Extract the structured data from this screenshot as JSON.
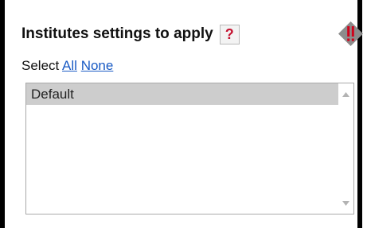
{
  "section": {
    "heading": "Institutes settings to apply",
    "help_label": "?",
    "warning_icon": "warning-diamond-icon"
  },
  "select": {
    "prefix": "Select",
    "all_label": "All",
    "none_label": "None"
  },
  "listbox": {
    "options": [
      {
        "label": "Default",
        "selected": true
      }
    ]
  },
  "colors": {
    "link": "#1a5bc4",
    "help_text": "#c41230",
    "warning_diamond": "#8c8c8c",
    "warning_mark": "#d0021b",
    "selected_row": "#cdcdcd"
  }
}
